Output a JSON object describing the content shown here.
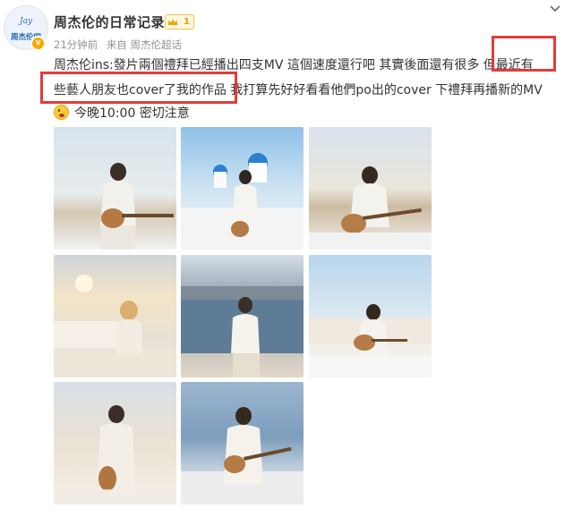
{
  "post": {
    "author": "周杰伦的日常记录",
    "level": "1",
    "time": "21分钟前",
    "source": "来自 周杰伦超话",
    "avatar_text_top": "Jay",
    "avatar_text_bottom": "周杰伦吧",
    "verified_mark": "v",
    "text_line1": "周杰伦ins:發片兩個禮拜已經播出四支MV 這個速度還行吧 其實後面還有很多 但最近有",
    "text_line2": "些藝人朋友也cover了我的作品 我打算先好好看看他們po出的cover 下禮拜再播新的MV",
    "text_line3": "今晚10:00 密切注意"
  },
  "photos": [
    {
      "name": "photo-1"
    },
    {
      "name": "photo-2"
    },
    {
      "name": "photo-3"
    },
    {
      "name": "photo-4"
    },
    {
      "name": "photo-5"
    },
    {
      "name": "photo-6"
    },
    {
      "name": "photo-7"
    },
    {
      "name": "photo-8"
    }
  ],
  "highlight_color": "#e23b3b",
  "icons": [
    "chevron-down-icon",
    "crown-icon",
    "verified-icon",
    "emoji-icon"
  ]
}
